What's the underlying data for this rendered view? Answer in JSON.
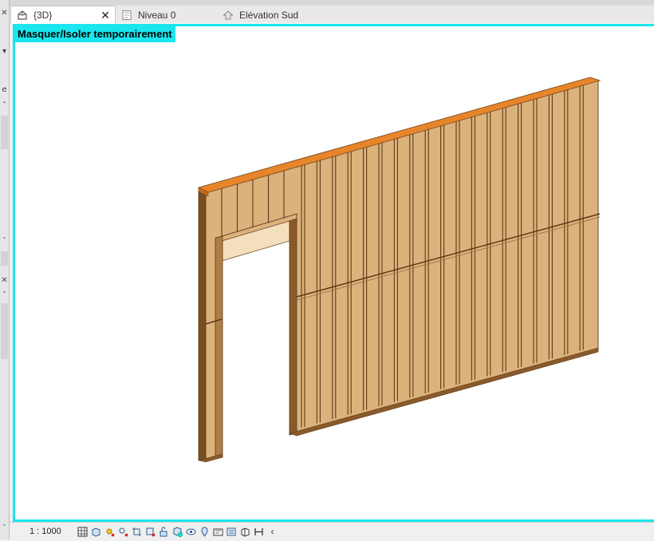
{
  "tabs": [
    {
      "label": "{3D}",
      "icon": "3d-house-icon",
      "active": true,
      "closable": true
    },
    {
      "label": "Niveau 0",
      "icon": "floor-plan-icon",
      "active": false
    },
    {
      "label": "Elévation Sud",
      "icon": "elevation-icon",
      "active": false
    }
  ],
  "viewport": {
    "banner": "Masquer/Isoler temporairement",
    "border_color": "#19e6ef"
  },
  "status_bar": {
    "scale": "1 : 1000",
    "icons": [
      "detail-level-icon",
      "visual-style-icon",
      "sun-path-icon",
      "shadows-icon",
      "crop-view-icon",
      "show-crop-icon",
      "unlock-view-icon",
      "temporary-hide-icon",
      "reveal-hidden-icon",
      "analytical-model-icon",
      "highlight-icon",
      "view-properties-icon",
      "constraints-icon",
      "render-icon",
      "scroll-left-icon"
    ]
  },
  "colors": {
    "wood_face": "#dcb27c",
    "wood_dark": "#8a5a2b",
    "top_plate": "#e8852a"
  }
}
